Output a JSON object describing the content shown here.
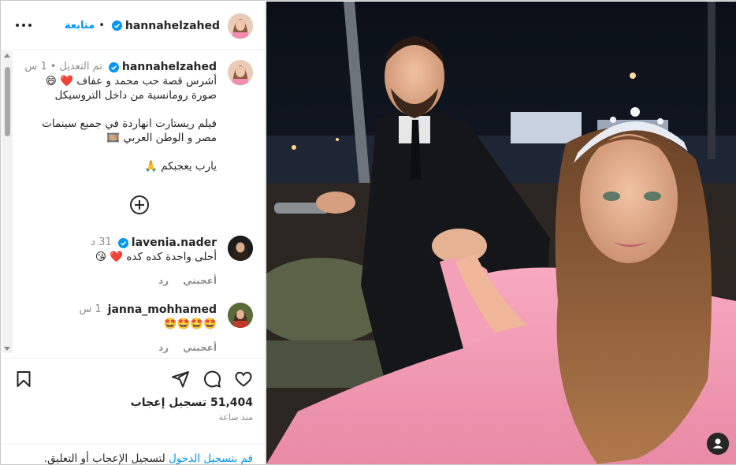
{
  "post": {
    "author": {
      "username": "hannahelzahed",
      "verified": true,
      "follow_label": "متابعة",
      "more_icon": "more-horizontal-icon"
    },
    "caption": {
      "username": "hannahelzahed",
      "edited_label": "تم التعديل",
      "age": "1 س",
      "lines": [
        "أشرس قصة حب محمد و عفاف ❤️ 😄",
        "صورة رومانسية من داخل التروسيكل",
        "",
        "فيلم ريستارت انهاردة في جميع سينمات",
        "مصر و الوطن العربي 🎞️",
        "",
        "يارب يعجبكم 🙏"
      ]
    },
    "load_more_icon": "plus-circle-icon",
    "comments": [
      {
        "username": "lavenia.nader",
        "verified": true,
        "age": "31 د",
        "text": "أحلى واحدة كده كده ❤️ 😘",
        "like_label": "أعجبني",
        "reply_label": "رد"
      },
      {
        "username": "janna_mohhamed",
        "verified": false,
        "age": "1 س",
        "text": "🤩🤩🤩🤩",
        "like_label": "أعجبني",
        "reply_label": "رد"
      }
    ],
    "actions": {
      "like_icon": "heart-icon",
      "comment_icon": "comment-icon",
      "share_icon": "send-icon",
      "save_icon": "bookmark-icon"
    },
    "likes_count": "51,404",
    "likes_label": "تسجيل إعجاب",
    "posted_time": "منذ ساعة",
    "login_prompt": {
      "link": "قم بتسجيل الدخول",
      "rest": "لتسجيل الإعجاب أو التعليق."
    },
    "photo": {
      "tag_icon": "user-tag-icon"
    }
  },
  "colors": {
    "accent": "#0095f6",
    "text": "#262626",
    "secondary": "#8e8e8e",
    "heart": "#ed4956"
  }
}
